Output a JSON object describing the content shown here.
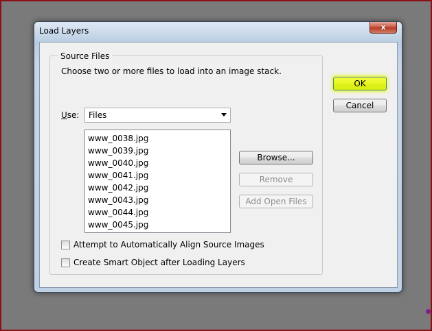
{
  "dialog": {
    "title": "Load Layers",
    "close_glyph": "x"
  },
  "source_files": {
    "group_label": "Source Files",
    "description": "Choose two or more files to load into an image stack.",
    "use_label_underlined": "U",
    "use_label_rest": "se:",
    "use_value": "Files",
    "files": [
      "www_0038.jpg",
      "www_0039.jpg",
      "www_0040.jpg",
      "www_0041.jpg",
      "www_0042.jpg",
      "www_0043.jpg",
      "www_0044.jpg",
      "www_0045.jpg"
    ],
    "browse_label": "Browse...",
    "remove_label": "Remove",
    "add_open_files_label": "Add Open Files"
  },
  "options": {
    "align_label": "Attempt to Automatically Align Source Images",
    "align_checked": false,
    "smart_object_label": "Create Smart Object after Loading Layers",
    "smart_object_checked": false
  },
  "actions": {
    "ok_label": "OK",
    "cancel_label": "Cancel"
  },
  "colors": {
    "ok_highlight": "#e8f728",
    "frame_border": "#8b0f16",
    "background": "#7a7a7a"
  }
}
